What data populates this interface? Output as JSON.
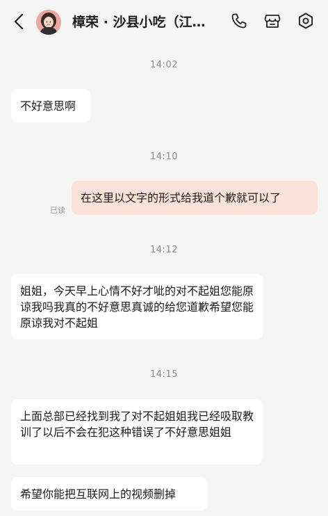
{
  "header": {
    "shop_name": "樟荣 · 沙县小吃（江…",
    "back_icon": "chevron-left-icon",
    "call_icon": "phone-icon",
    "store_icon": "store-icon",
    "settings_icon": "gear-icon"
  },
  "messages": [
    {
      "type": "time",
      "text": "14:02"
    },
    {
      "type": "msg",
      "from": "other",
      "text": "不好意思啊"
    },
    {
      "type": "time",
      "text": "14:10"
    },
    {
      "type": "msg",
      "from": "self",
      "text": "在这里以文字的形式给我道个歉就可以了",
      "status": "已读"
    },
    {
      "type": "time",
      "text": "14:12"
    },
    {
      "type": "msg",
      "from": "other",
      "text": "姐姐，今天早上心情不好才呲的对不起姐您能原谅我吗我真的不好意思真诚的给您道歉希望您能原谅我对不起姐"
    },
    {
      "type": "time",
      "text": "14:15"
    },
    {
      "type": "msg",
      "from": "other",
      "text": "上面总部已经找到我了对不起姐姐我已经吸取教训了以后不会在犯这种错误了不好意思姐姐"
    },
    {
      "type": "msg",
      "from": "other",
      "text": "希望你能把互联网上的视频删掉"
    }
  ],
  "colors": {
    "background": "#f5f5f5",
    "bubble_other": "#ffffff",
    "bubble_self": "#fbe3da",
    "time_text": "#8c8c8c"
  }
}
